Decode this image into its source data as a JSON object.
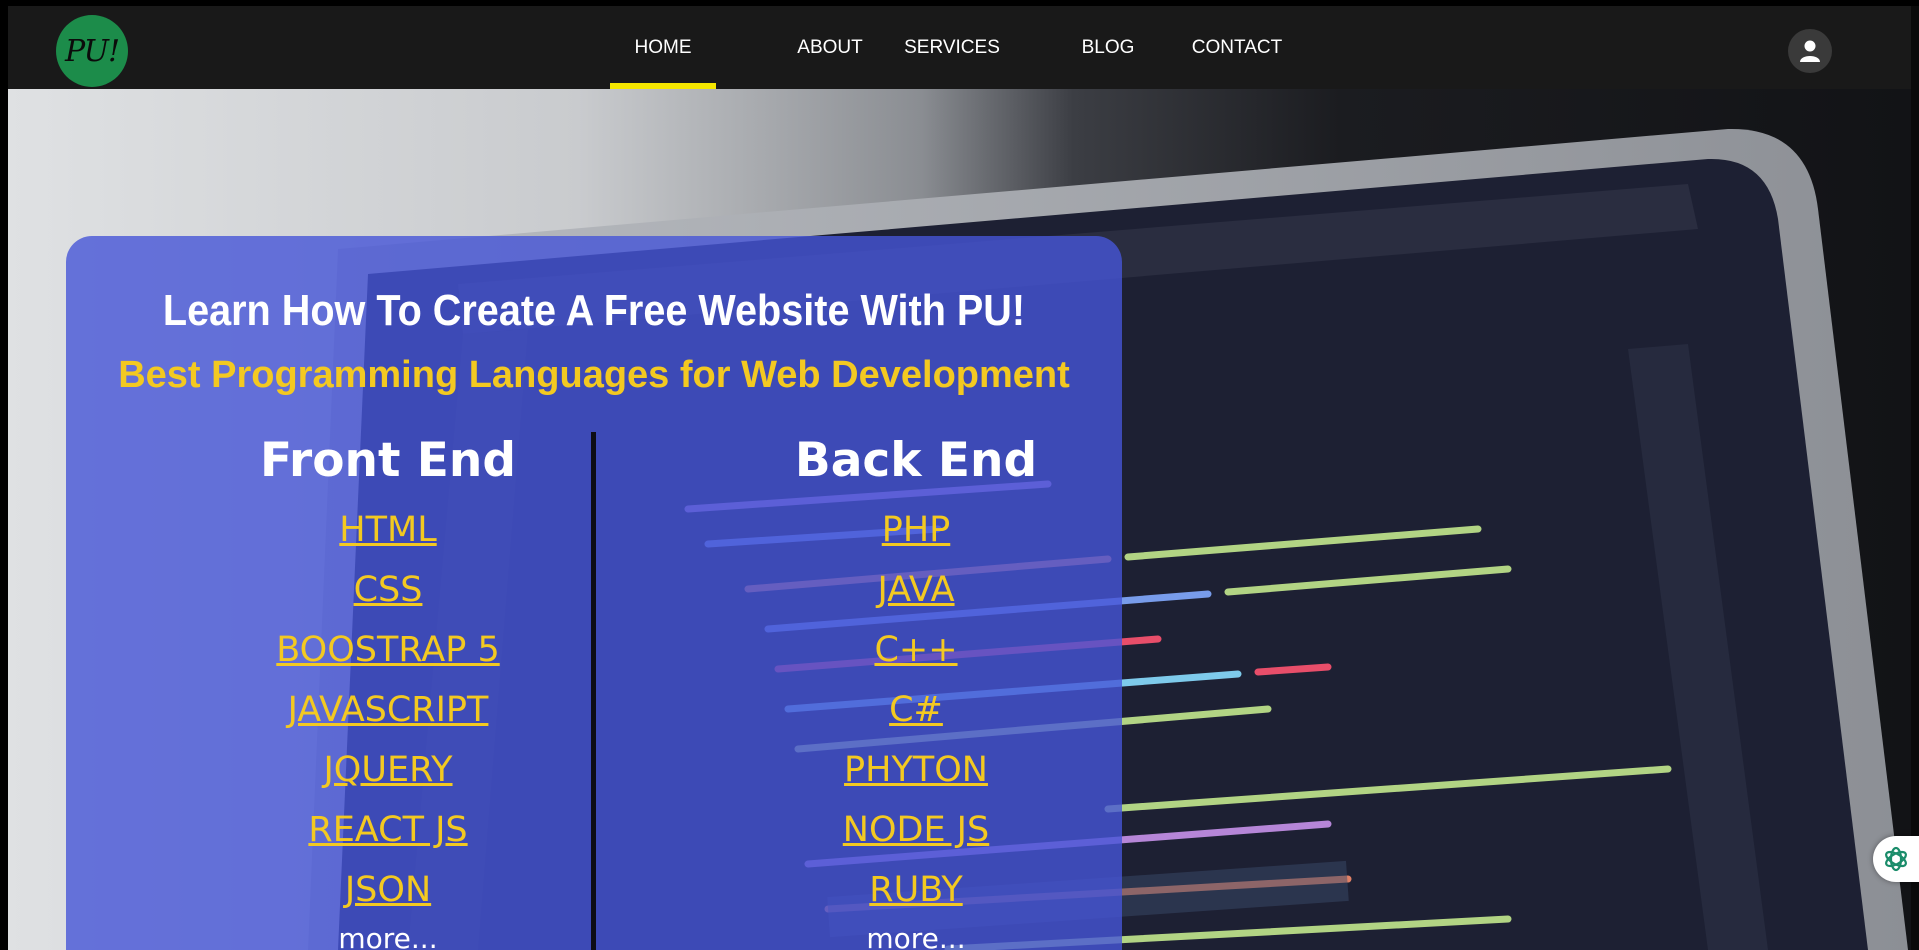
{
  "logo": {
    "text": "PU!"
  },
  "nav": {
    "items": [
      {
        "label": "HOME",
        "active": true
      },
      {
        "label": "ABOUT",
        "active": false
      },
      {
        "label": "SERVICES",
        "active": false
      },
      {
        "label": "BLOG",
        "active": false
      },
      {
        "label": "CONTACT",
        "active": false
      }
    ]
  },
  "icons": {
    "user": "user-icon",
    "widget": "assistant-sparkle-icon"
  },
  "hero": {
    "title": "Learn How To Create A Free Website With PU!",
    "subtitle": "Best Programming Languages for Web Development",
    "front_end": {
      "title": "Front End",
      "items": [
        "HTML",
        "CSS",
        "BOOSTRAP 5",
        "JAVASCRIPT",
        "JQUERY",
        "REACT JS",
        "JSON"
      ],
      "more": "more..."
    },
    "back_end": {
      "title": "Back End",
      "items": [
        "PHP",
        "JAVA",
        "C++",
        "C#",
        "PHYTON",
        "NODE JS",
        "RUBY"
      ],
      "more": "more..."
    }
  },
  "colors": {
    "navbar": "#191919",
    "active_indicator": "#f5e600",
    "logo": "#1c8c4a",
    "card": "#4655d7",
    "accent_text": "#f3c921"
  }
}
